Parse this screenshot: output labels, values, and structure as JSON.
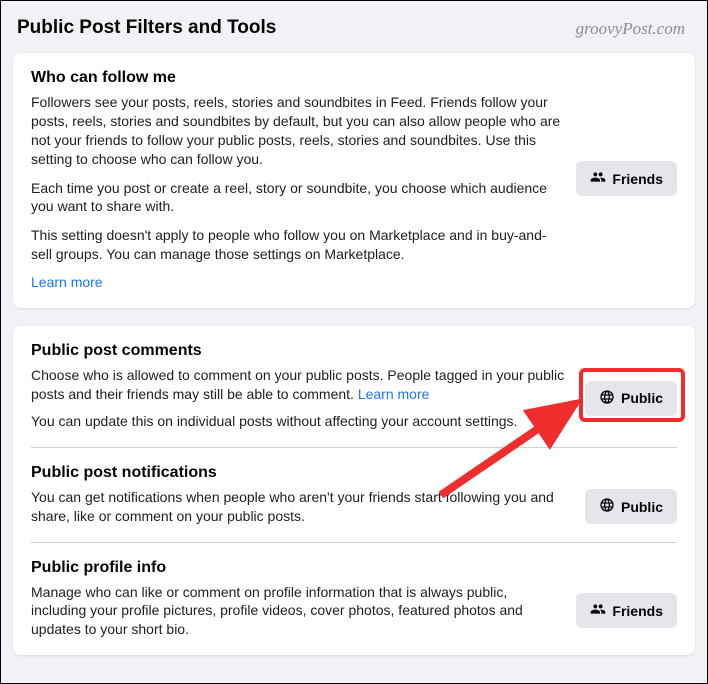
{
  "page_title": "Public Post Filters and Tools",
  "watermark": "groovyPost.com",
  "follow": {
    "title": "Who can follow me",
    "p1": "Followers see your posts, reels, stories and soundbites in Feed. Friends follow your posts, reels, stories and soundbites by default, but you can also allow people who are not your friends to follow your public posts, reels, stories and soundbites. Use this setting to choose who can follow you.",
    "p2": "Each time you post or create a reel, story or soundbite, you choose which audience you want to share with.",
    "p3": "This setting doesn't apply to people who follow you on Marketplace and in buy-and-sell groups. You can manage those settings on Marketplace.",
    "learn_more": "Learn more",
    "value": "Friends"
  },
  "comments": {
    "title": "Public post comments",
    "desc_lead": "Choose who is allowed to comment on your public posts. People tagged in your public posts and their friends may still be able to comment. ",
    "learn_more": "Learn more",
    "desc_sub": "You can update this on individual posts without affecting your account settings.",
    "value": "Public"
  },
  "notifications": {
    "title": "Public post notifications",
    "desc": "You can get notifications when people who aren't your friends start following you and share, like or comment on your public posts.",
    "value": "Public"
  },
  "profile": {
    "title": "Public profile info",
    "desc": "Manage who can like or comment on profile information that is always public, including your profile pictures, profile videos, cover photos, featured photos and updates to your short bio.",
    "value": "Friends"
  }
}
